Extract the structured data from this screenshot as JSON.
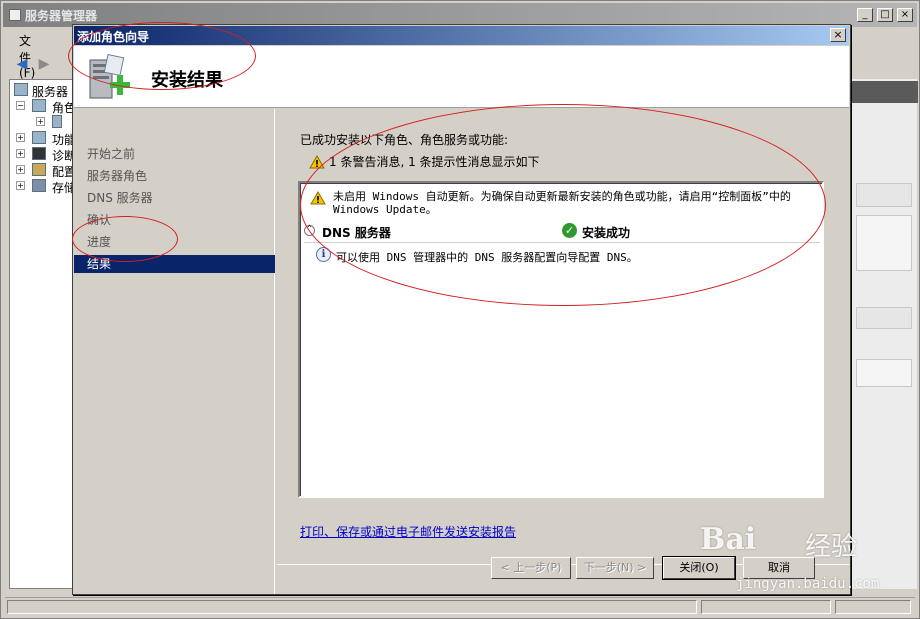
{
  "main_window": {
    "title": "服务器管理器",
    "menu": {
      "file": "文件(F)"
    },
    "tree": [
      {
        "label": "服务器"
      },
      {
        "label": "角色"
      },
      {
        "label": ""
      },
      {
        "label": "功能"
      },
      {
        "label": "诊断"
      },
      {
        "label": "配置"
      },
      {
        "label": "存储"
      }
    ]
  },
  "wizard": {
    "title": "添加角色向导",
    "close_glyph": "×",
    "header_title": "安装结果",
    "nav": [
      {
        "label": "开始之前",
        "active": false
      },
      {
        "label": "服务器角色",
        "active": false
      },
      {
        "label": "DNS 服务器",
        "active": false
      },
      {
        "label": "确认",
        "active": false
      },
      {
        "label": "进度",
        "active": false
      },
      {
        "label": "结果",
        "active": true
      }
    ],
    "heading": "已成功安装以下角色、角色服务或功能:",
    "summary": "1 条警告消息, 1 条提示性消息显示如下",
    "results": {
      "warning_text": "未启用 Windows 自动更新。为确保自动更新最新安装的角色或功能，请启用“控制面板”中的 Windows Update。",
      "role_name": "DNS 服务器",
      "role_status": "安装成功",
      "info_text": "可以使用 DNS 管理器中的 DNS 服务器配置向导配置 DNS。"
    },
    "report_link": "打印、保存或通过电子邮件发送安装报告",
    "buttons": {
      "prev": "< 上一步(P)",
      "next": "下一步(N) >",
      "close": "关闭(O)",
      "cancel": "取消"
    }
  },
  "watermark": {
    "logo": "Bai",
    "suffix": "经验",
    "url": "jingyan.baidu.com"
  },
  "colors": {
    "dialog_titlebar": "#0a246a",
    "nav_active": "#0a246a",
    "annotation": "#d42020",
    "link": "#0000cc",
    "success": "#2e9a2e",
    "warning": "#f5c400"
  }
}
